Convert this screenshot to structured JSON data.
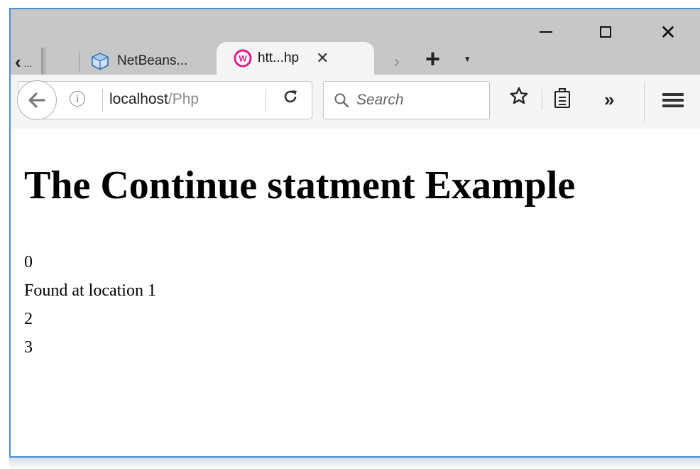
{
  "tabs": {
    "overflow_label": "...",
    "inactive": {
      "label": "NetBeans...",
      "icon": "netbeans-cube-icon"
    },
    "active": {
      "label": "htt...hp",
      "icon": "wamp-server-icon",
      "close": "✕"
    },
    "new_tab": "+",
    "list_menu": "▾",
    "scroll_arrow": "›"
  },
  "window_controls": {
    "minimize": "minimize",
    "maximize": "maximize",
    "close": "✕"
  },
  "navbar": {
    "url_host": "localhost",
    "url_path": "/Php",
    "search_placeholder": "Search",
    "info_glyph": "i",
    "reload_glyph": "↻",
    "overflow_glyph": "»"
  },
  "page": {
    "title": "The Continue statment Example",
    "output_lines": [
      "0",
      "Found at location 1",
      "2",
      "3"
    ]
  },
  "colors": {
    "accent_border": "#4a90d9",
    "wamp_pink": "#e5198a",
    "netbeans_blue": "#2b6db5"
  }
}
